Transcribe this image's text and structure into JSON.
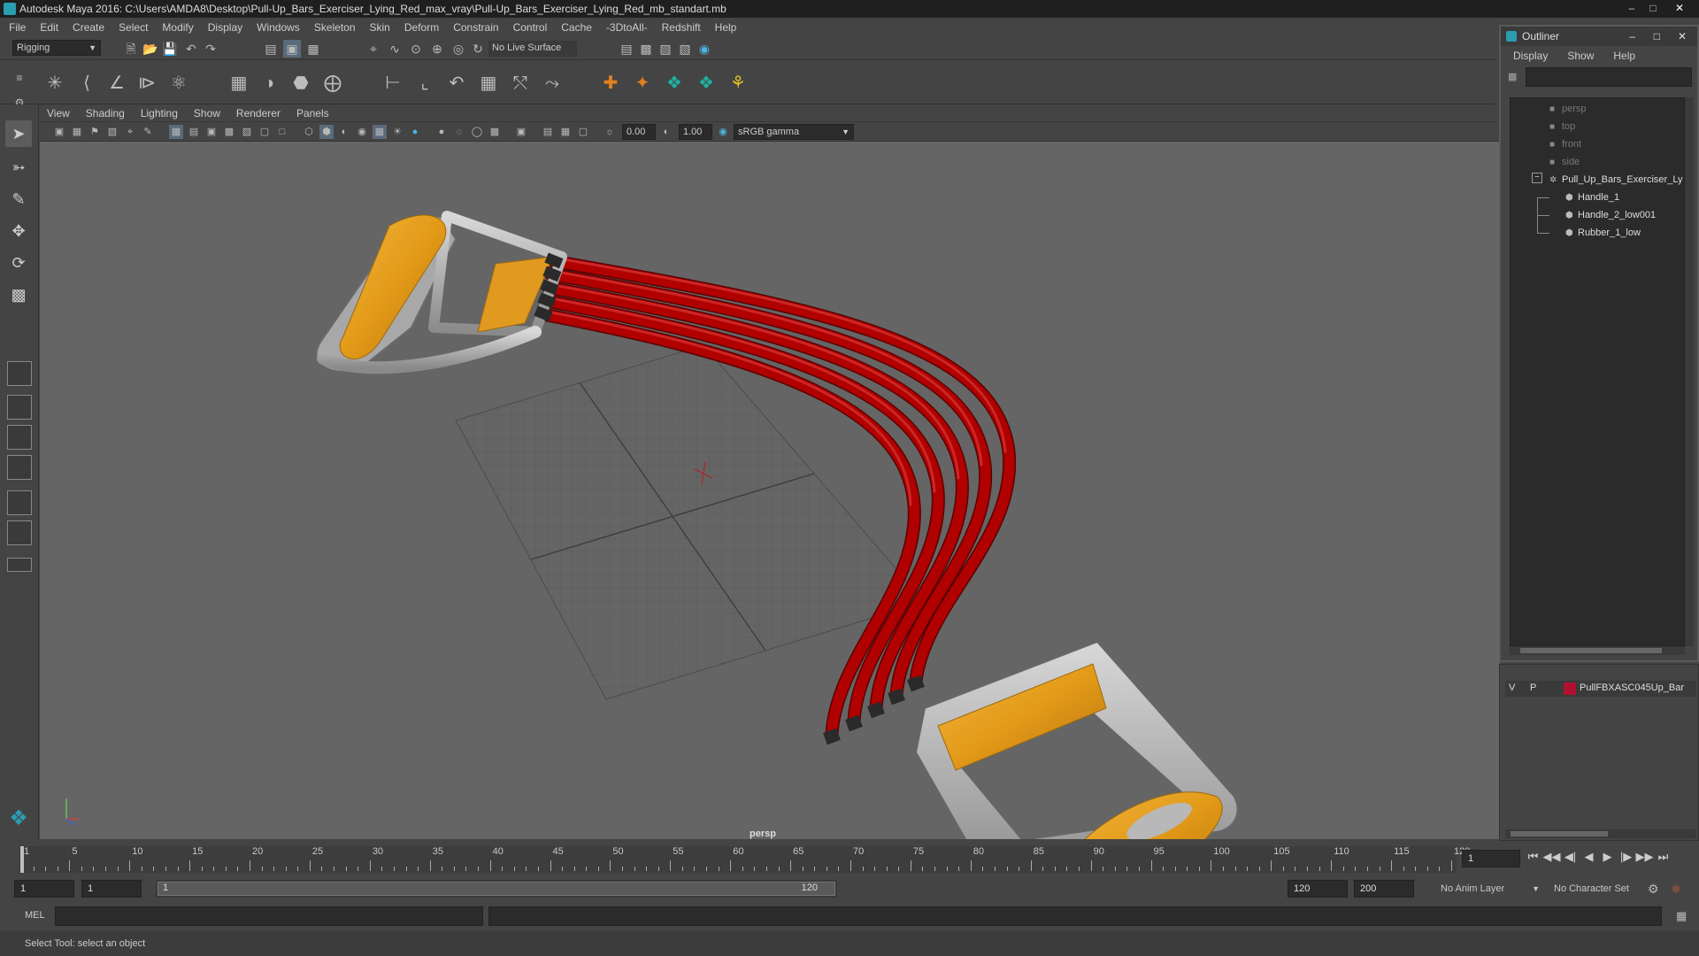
{
  "app": {
    "title": "Autodesk Maya 2016: C:\\Users\\AMDA8\\Desktop\\Pull-Up_Bars_Exerciser_Lying_Red_max_vray\\Pull-Up_Bars_Exerciser_Lying_Red_mb_standart.mb",
    "accent_color": "#2a9db0"
  },
  "menubar": [
    "File",
    "Edit",
    "Create",
    "Select",
    "Modify",
    "Display",
    "Windows",
    "Skeleton",
    "Skin",
    "Deform",
    "Constrain",
    "Control",
    "Cache",
    "-3DtoAll-",
    "Redshift",
    "Help"
  ],
  "statusline": {
    "mode": "Rigging",
    "live_surface": "No Live Surface"
  },
  "viewport": {
    "menu": [
      "View",
      "Shading",
      "Lighting",
      "Show",
      "Renderer",
      "Panels"
    ],
    "exposure": "0.00",
    "gamma": "1.00",
    "colorspace": "sRGB gamma",
    "camera_label": "persp",
    "colors": {
      "rubber": "#a00000",
      "grip": "#e8a020",
      "frame": "#b8b8b8",
      "background": "#656565"
    }
  },
  "outliner": {
    "title": "Outliner",
    "menu": [
      "Display",
      "Show",
      "Help"
    ],
    "items": [
      {
        "label": "persp",
        "kind": "camera"
      },
      {
        "label": "top",
        "kind": "camera"
      },
      {
        "label": "front",
        "kind": "camera"
      },
      {
        "label": "side",
        "kind": "camera"
      },
      {
        "label": "Pull_Up_Bars_Exerciser_Ly",
        "kind": "group"
      },
      {
        "label": "Handle_1",
        "kind": "mesh"
      },
      {
        "label": "Handle_2_low001",
        "kind": "mesh"
      },
      {
        "label": "Rubber_1_low",
        "kind": "mesh"
      }
    ]
  },
  "layers": {
    "v": "V",
    "p": "P",
    "name": "PullFBXASC045Up_Bar",
    "color": "#b01030"
  },
  "timeslider": {
    "ticks": [
      "1",
      "5",
      "10",
      "15",
      "20",
      "25",
      "30",
      "35",
      "40",
      "45",
      "50",
      "55",
      "60",
      "65",
      "70",
      "75",
      "80",
      "85",
      "90",
      "95",
      "100",
      "105",
      "110",
      "115",
      "120"
    ],
    "current_frame": "1"
  },
  "range": {
    "start": "1",
    "playback_start": "1",
    "slider_start": "1",
    "slider_end": "120",
    "playback_end": "120",
    "end": "200",
    "anim_layer": "No Anim Layer",
    "character_set": "No Character Set"
  },
  "cmdline": {
    "lang": "MEL"
  },
  "helpline": "Select Tool: select an object"
}
